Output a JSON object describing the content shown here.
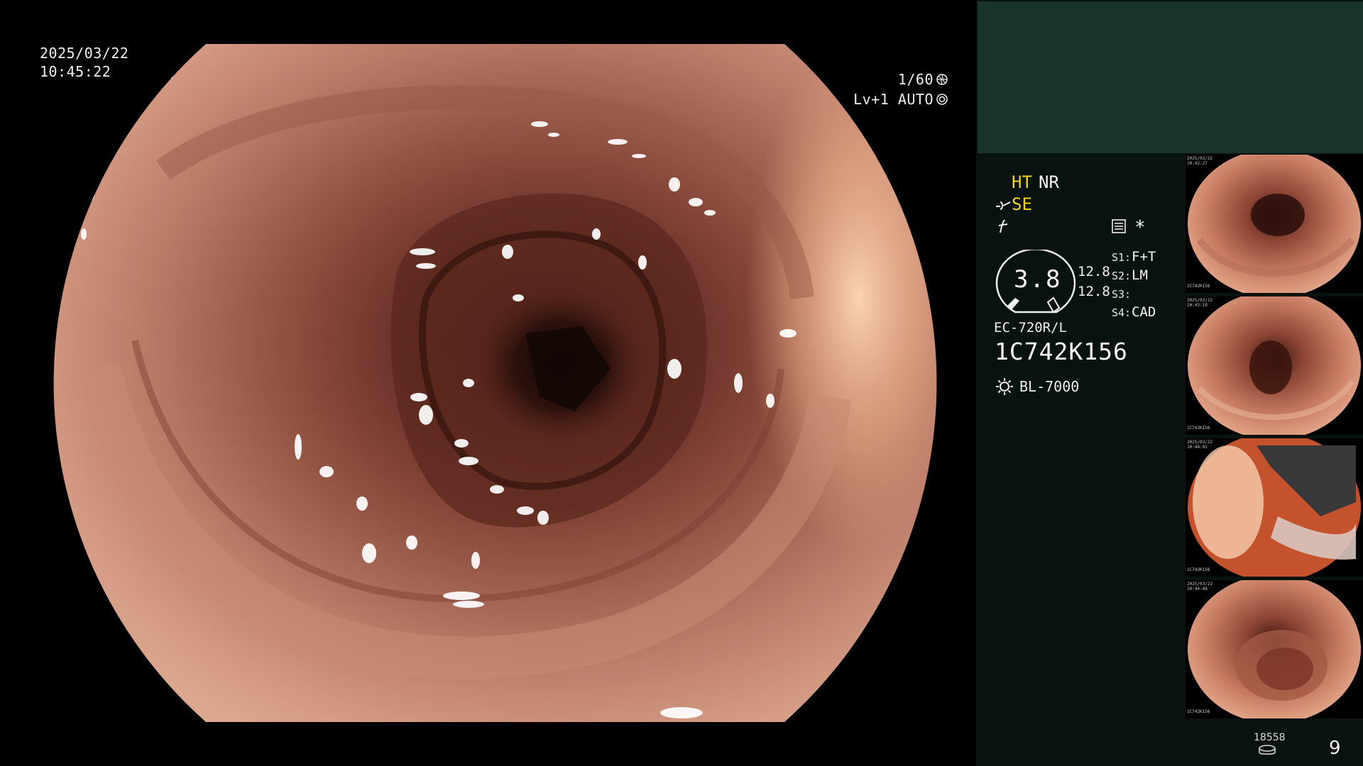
{
  "main_view": {
    "date": "2025/03/22",
    "time": "10:45:22",
    "shutter": "1/60",
    "level_mode": "Lv+1 AUTO"
  },
  "panel": {
    "mode_ht": "HT",
    "mode_nr": "NR",
    "mode_se": "SE",
    "star": "*",
    "gauge_value": "3.8",
    "gauge_side_top": "12.8",
    "gauge_side_bottom": "12.8",
    "slots": [
      {
        "label": "S1:",
        "value": "F+T"
      },
      {
        "label": "S2:",
        "value": "LM"
      },
      {
        "label": "S3:",
        "value": ""
      },
      {
        "label": "S4:",
        "value": "CAD"
      }
    ],
    "scope_model": "EC-720R/L",
    "scope_serial": "1C742K156",
    "light_source": "BL-7000"
  },
  "thumbnails": [
    {
      "date": "2025/03/22",
      "time": "10:42:27",
      "serial": "1C742K156"
    },
    {
      "date": "2025/03/22",
      "time": "10:43:10",
      "serial": "1C742K156"
    },
    {
      "date": "2025/03/22",
      "time": "10:44:02",
      "serial": "1C742K156"
    },
    {
      "date": "2025/03/22",
      "time": "10:44:48",
      "serial": "1C742K156"
    }
  ],
  "footer": {
    "counter": "18558",
    "page_number": "9"
  },
  "colors": {
    "panel_bg": "#08120f",
    "panel_top": "#17332c",
    "highlight": "#f2d31b"
  }
}
